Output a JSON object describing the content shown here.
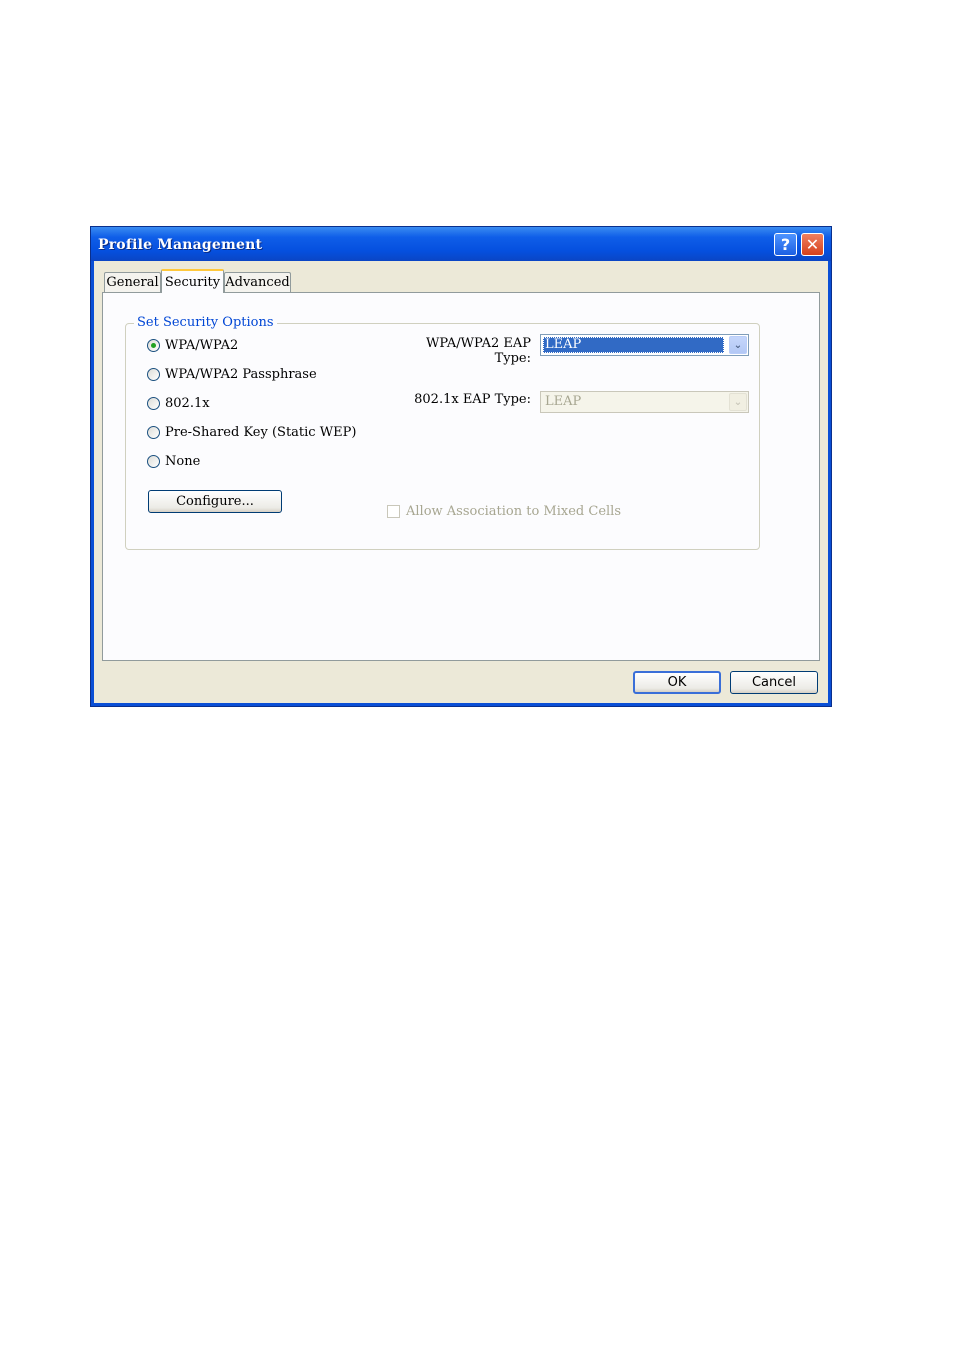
{
  "window": {
    "title": "Profile Management",
    "help_glyph": "?",
    "close_glyph": "✕"
  },
  "tabs": [
    {
      "label": "General"
    },
    {
      "label": "Security",
      "selected": true
    },
    {
      "label": "Advanced"
    }
  ],
  "security": {
    "group_title": "Set Security Options",
    "options": [
      {
        "label": "WPA/WPA2",
        "checked": true
      },
      {
        "label": "WPA/WPA2 Passphrase",
        "checked": false
      },
      {
        "label": "802.1x",
        "checked": false
      },
      {
        "label": "Pre-Shared Key (Static WEP)",
        "checked": false
      },
      {
        "label": "None",
        "checked": false
      }
    ],
    "configure_label": "Configure...",
    "wpa_eap_label": "WPA/WPA2 EAP Type:",
    "wpa_eap_value": "LEAP",
    "dot1x_eap_label": "802.1x EAP Type:",
    "dot1x_eap_value": "LEAP",
    "mixed_cells_label": "Allow Association to Mixed Cells",
    "dropdown_arrow": "⌄"
  },
  "footer": {
    "ok_label": "OK",
    "cancel_label": "Cancel"
  },
  "colors": {
    "title_bar": "#0a4fd6",
    "dialog_face": "#ece9d8",
    "group_title": "#0046d5",
    "selection": "#316ac5"
  }
}
